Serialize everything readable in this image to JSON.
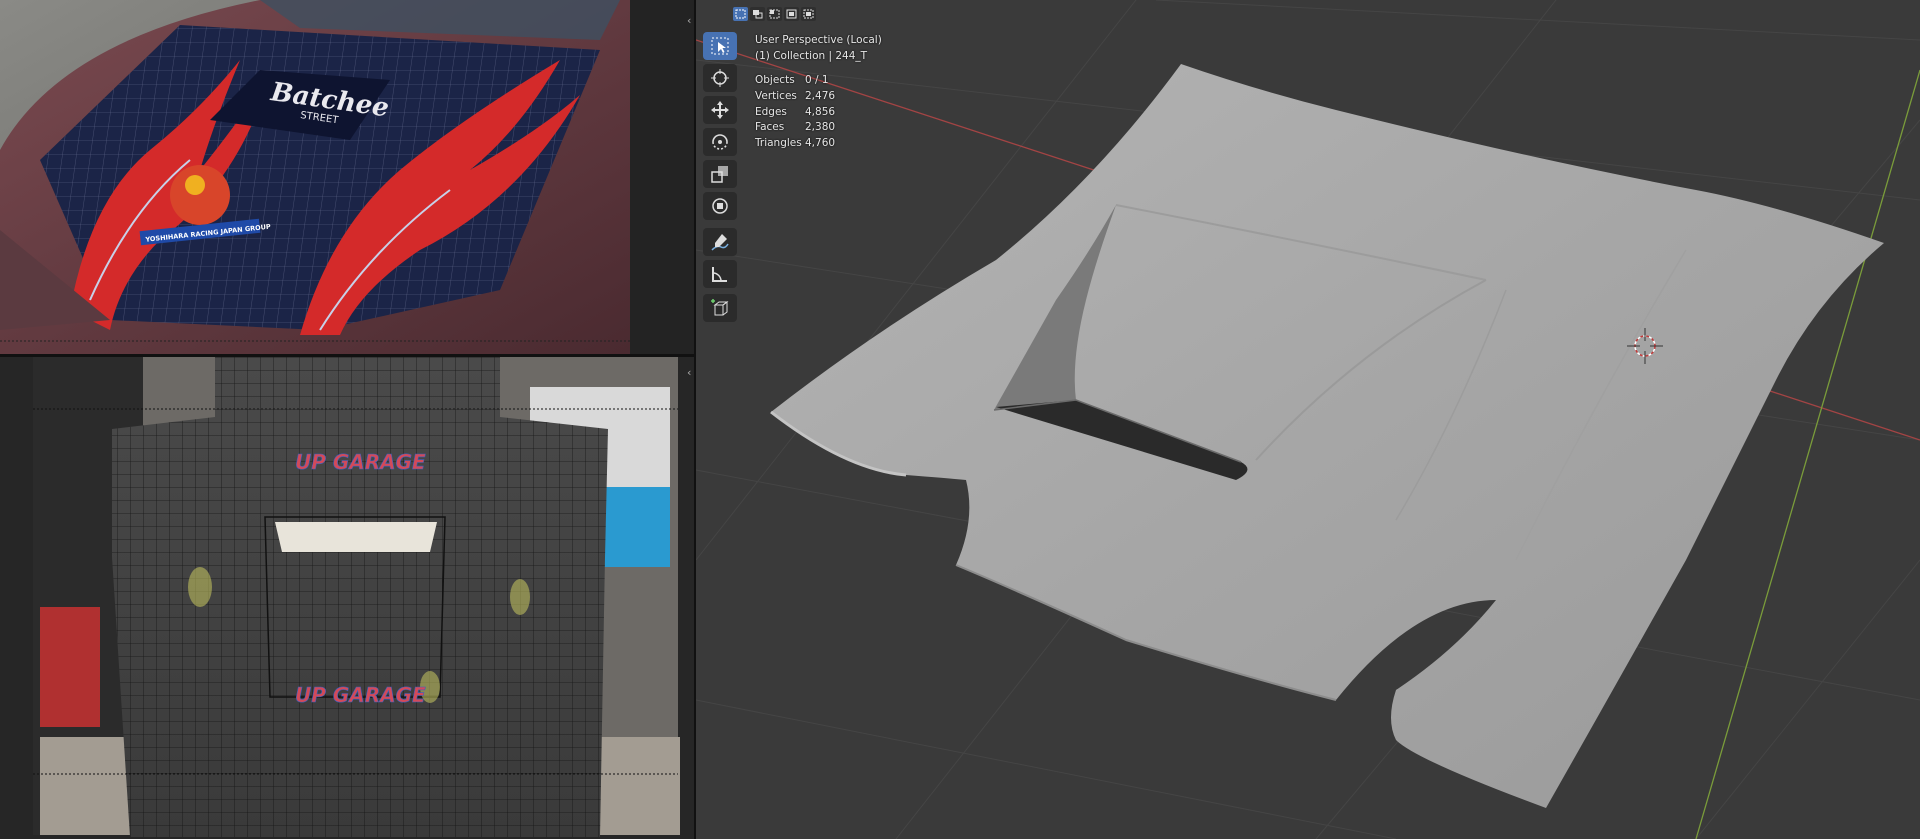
{
  "viewport": {
    "perspective_label": "User Perspective (Local)",
    "collection_label": "(1) Collection | 244_T",
    "stats": [
      {
        "label": "Objects",
        "value": "0 / 1"
      },
      {
        "label": "Vertices",
        "value": "2,476"
      },
      {
        "label": "Edges",
        "value": "4,856"
      },
      {
        "label": "Faces",
        "value": "2,380"
      },
      {
        "label": "Triangles",
        "value": "4,760"
      }
    ]
  },
  "reference_top": {
    "hood_text_brand": "Batchee",
    "hood_text_sub": "STREET",
    "banner_text": "YOSHIHARA RACING JAPAN GROUP"
  },
  "reference_bottom": {
    "watermark_1": "UP GARAGE",
    "watermark_2": "UP GARAGE"
  },
  "tools": [
    {
      "name": "select-box-tool",
      "active": true
    },
    {
      "name": "cursor-tool",
      "active": false
    },
    {
      "name": "move-tool",
      "active": false
    },
    {
      "name": "rotate-tool",
      "active": false
    },
    {
      "name": "scale-tool",
      "active": false
    },
    {
      "name": "transform-tool",
      "active": false
    },
    {
      "name": "annotate-tool",
      "active": false
    },
    {
      "name": "measure-tool",
      "active": false
    },
    {
      "name": "add-cube-tool",
      "active": false
    }
  ],
  "colors": {
    "accent": "#4772b3",
    "viewport_bg": "#3a3a3a",
    "model": "#a9a9a9",
    "x_axis": "#b83a3a",
    "y_axis": "#7ea33a"
  }
}
